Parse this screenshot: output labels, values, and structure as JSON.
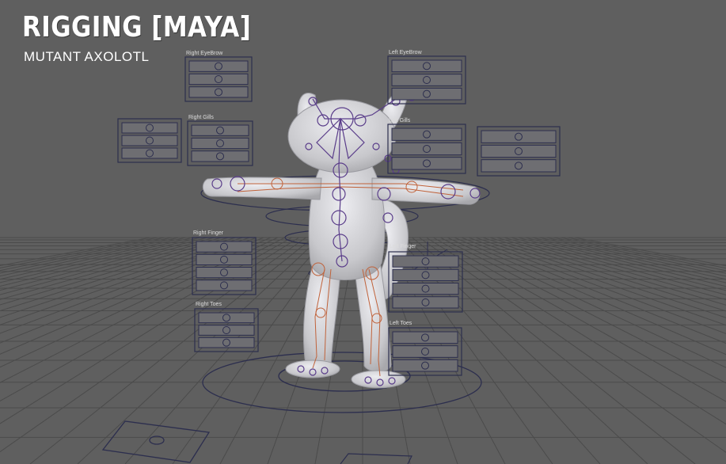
{
  "header": {
    "title": "RIGGING [MAYA]",
    "subtitle": "MUTANT AXOLOTL"
  },
  "panels": {
    "right_eyebrow": "Right EyeBrow",
    "left_eyebrow": "Left EyeBrow",
    "right_gills": "Right Gills",
    "left_gills": "Left Gills",
    "right_finger": "Right Finger",
    "left_finger": "Left Finger",
    "right_toes": "Right Toes",
    "left_toes": "Left Toes"
  },
  "colors": {
    "viewport_bg": "#5f5f5f",
    "grid": "#4a4a4a",
    "mesh": "#d2d2d6",
    "joints": "#5a3d8a",
    "ik_chain": "#c0623a",
    "control_curves": "#2c2e4e"
  }
}
